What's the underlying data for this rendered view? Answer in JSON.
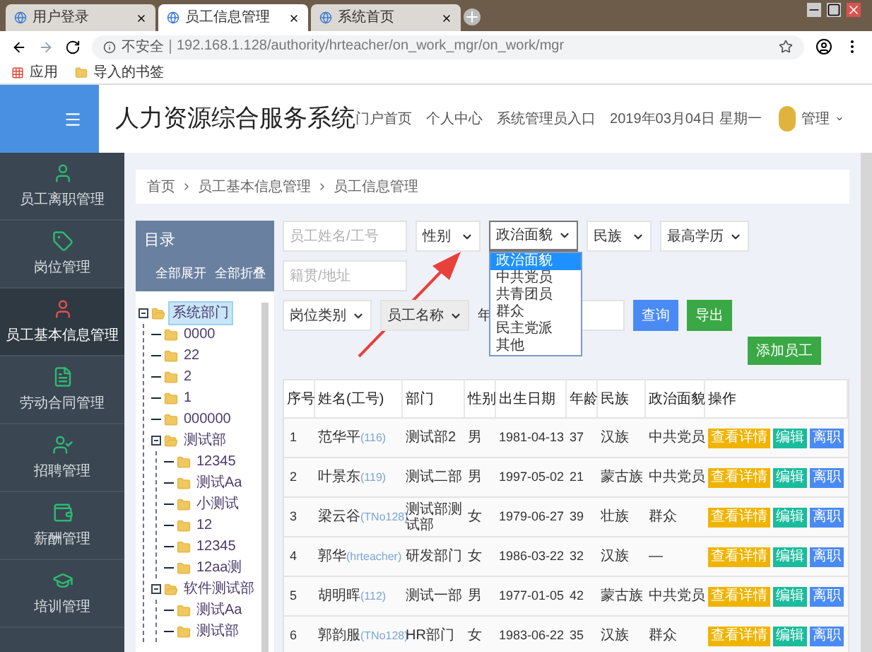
{
  "browser": {
    "tabs": [
      {
        "title": "用户登录",
        "selected": false
      },
      {
        "title": "员工信息管理",
        "selected": true
      },
      {
        "title": "系统首页",
        "selected": false
      }
    ],
    "address": {
      "security": "不安全",
      "url": "192.168.1.128/authority/hrteacher/on_work_mgr/on_work/mgr"
    },
    "bookmarks": [
      "应用",
      "导入的书签"
    ]
  },
  "header": {
    "title": "人力资源综合服务系统",
    "nav": [
      "门户首页",
      "个人中心",
      "系统管理员入口"
    ],
    "date": "2019年03月04日 星期一",
    "user": "管理"
  },
  "sidebar": {
    "items": [
      {
        "label": "员工离职管理",
        "selected": false
      },
      {
        "label": "岗位管理",
        "selected": false
      },
      {
        "label": "员工基本信息管理",
        "selected": true
      },
      {
        "label": "劳动合同管理",
        "selected": false
      },
      {
        "label": "招聘管理",
        "selected": false
      },
      {
        "label": "薪酬管理",
        "selected": false
      },
      {
        "label": "培训管理",
        "selected": false
      }
    ]
  },
  "breadcrumb": [
    "首页",
    "员工基本信息管理",
    "员工信息管理"
  ],
  "tree": {
    "title": "目录",
    "buttons": [
      "全部展开",
      "全部折叠"
    ],
    "nodes": [
      {
        "label": "系统部门",
        "selected": true,
        "expanded": true,
        "children": [
          {
            "label": "0000",
            "selected": false
          },
          {
            "label": "22",
            "selected": false
          },
          {
            "label": "2",
            "selected": false
          },
          {
            "label": "1",
            "selected": false
          },
          {
            "label": "000000",
            "selected": false
          },
          {
            "label": "测试部",
            "selected": false,
            "expanded": true,
            "children": [
              {
                "label": "12345",
                "selected": false
              },
              {
                "label": "测试Aa",
                "selected": false
              },
              {
                "label": "小测试",
                "selected": false
              },
              {
                "label": "12",
                "selected": false
              },
              {
                "label": "12345",
                "selected": false
              },
              {
                "label": "12aa测",
                "selected": false
              }
            ]
          },
          {
            "label": "软件测试部",
            "selected": false,
            "expanded": true,
            "children": [
              {
                "label": "测试Aa",
                "selected": false
              },
              {
                "label": "测试部",
                "selected": false
              }
            ]
          }
        ]
      }
    ]
  },
  "filter_rows": [
    [
      {
        "kind": "input",
        "placeholder": "员工姓名/工号"
      },
      {
        "kind": "select",
        "label": "性别",
        "disabled": false
      },
      {
        "kind": "select",
        "label": "政治面貌",
        "disabled": false,
        "dropdown": [
          {
            "label": "政治面貌",
            "selected": true
          },
          {
            "label": "中共党员",
            "selected": false
          },
          {
            "label": "共青团员",
            "selected": false
          },
          {
            "label": "群众",
            "selected": false
          },
          {
            "label": "民主党派",
            "selected": false
          },
          {
            "label": "其他",
            "selected": false
          }
        ]
      },
      {
        "kind": "select",
        "label": "民族",
        "disabled": false
      },
      {
        "kind": "select",
        "label": "最高学历",
        "disabled": false
      }
    ],
    [
      {
        "kind": "input",
        "placeholder": "籍贯/地址"
      }
    ],
    [
      {
        "kind": "select",
        "label": "岗位类别",
        "disabled": false
      },
      {
        "kind": "select",
        "label": "员工名称",
        "disabled": true
      },
      {
        "kind": "label",
        "text": "年"
      },
      {
        "kind": "input"
      },
      {
        "kind": "button",
        "label": "查询",
        "color": "#4a8af4"
      },
      {
        "kind": "button",
        "label": "导出",
        "color": "#3aa845"
      }
    ]
  ],
  "add_button": "添加员工",
  "table": {
    "columns": [
      "序号",
      "姓名(工号)",
      "部门",
      "性别",
      "出生日期",
      "年龄",
      "民族",
      "政治面貌",
      "操作"
    ],
    "rows": [
      {
        "no": "1",
        "name": "范华平",
        "id": "(116)",
        "dept": "测试部2",
        "gender": "男",
        "birth": "1981-04-13",
        "age": "37",
        "ethnicity": "汉族",
        "politics": "中共党员",
        "actions": [
          {
            "kind": "view",
            "label": "查看详情"
          },
          {
            "kind": "edit",
            "label": "编辑"
          },
          {
            "kind": "leave",
            "label": "离职"
          }
        ]
      },
      {
        "no": "2",
        "name": "叶景东",
        "id": "(119)",
        "dept": "测试二部",
        "gender": "男",
        "birth": "1997-05-02",
        "age": "21",
        "ethnicity": "蒙古族",
        "politics": "中共党员",
        "actions": [
          {
            "kind": "view",
            "label": "查看详情"
          },
          {
            "kind": "edit",
            "label": "编辑"
          },
          {
            "kind": "leave",
            "label": "离职"
          }
        ]
      },
      {
        "no": "3",
        "name": "梁云谷",
        "id": "(TNo128)",
        "dept": "测试部测试部",
        "gender": "女",
        "birth": "1979-06-27",
        "age": "39",
        "ethnicity": "壮族",
        "politics": "群众",
        "actions": [
          {
            "kind": "view",
            "label": "查看详情"
          },
          {
            "kind": "edit",
            "label": "编辑"
          },
          {
            "kind": "leave",
            "label": "离职"
          }
        ]
      },
      {
        "no": "4",
        "name": "郭华",
        "id": "(hrteacher)",
        "dept": "研发部门",
        "gender": "女",
        "birth": "1986-03-22",
        "age": "32",
        "ethnicity": "汉族",
        "politics": "—",
        "actions": [
          {
            "kind": "view",
            "label": "查看详情"
          },
          {
            "kind": "edit",
            "label": "编辑"
          },
          {
            "kind": "leave",
            "label": "离职"
          }
        ]
      },
      {
        "no": "5",
        "name": "胡明晖",
        "id": "(112)",
        "dept": "测试一部",
        "gender": "男",
        "birth": "1977-01-05",
        "age": "42",
        "ethnicity": "蒙古族",
        "politics": "中共党员",
        "actions": [
          {
            "kind": "view",
            "label": "查看详情"
          },
          {
            "kind": "edit",
            "label": "编辑"
          },
          {
            "kind": "leave",
            "label": "离职"
          }
        ]
      },
      {
        "no": "6",
        "name": "郭韵服",
        "id": "(TNo128)",
        "dept": "HR部门",
        "gender": "女",
        "birth": "1983-06-22",
        "age": "35",
        "ethnicity": "汉族",
        "politics": "群众",
        "actions": [
          {
            "kind": "view",
            "label": "查看详情"
          },
          {
            "kind": "edit",
            "label": "编辑"
          },
          {
            "kind": "leave",
            "label": "离职"
          }
        ]
      }
    ]
  }
}
